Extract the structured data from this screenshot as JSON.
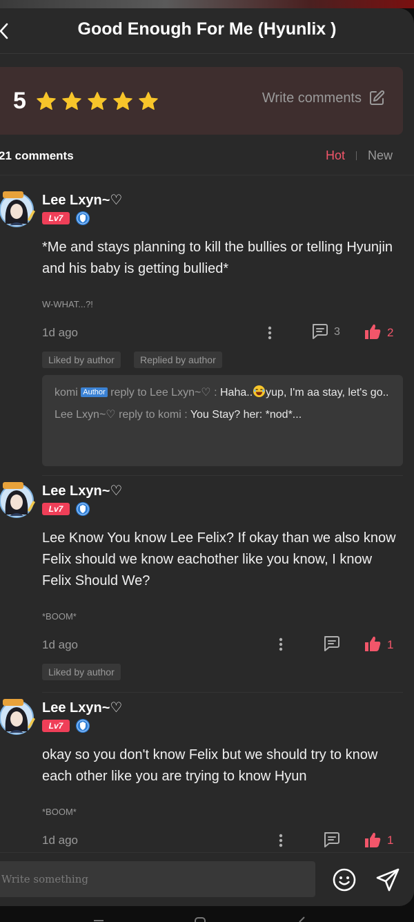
{
  "header": {
    "title": "Good Enough For Me (Hyunlix )"
  },
  "rating": {
    "score": "5",
    "stars": 5,
    "star_color": "#f7c52a",
    "write_comments_label": "Write comments"
  },
  "comments_bar": {
    "count_label": "21 comments",
    "sort_hot": "Hot",
    "sort_new": "New",
    "active_color": "#f2566a"
  },
  "comments": [
    {
      "username": "Lee Lxyn~♡",
      "level": "Lv7",
      "text": "*Me and stays planning to kill the bullies or telling Hyunjin and his baby is getting bullied*",
      "quote": "W-WHAT...?!",
      "time": "1d ago",
      "reply_count": "3",
      "like_count": "2",
      "tags": [
        "Liked by author",
        "Replied by author"
      ],
      "replies": [
        {
          "name": "komi",
          "author_chip": "Author",
          "reply_to": "reply to Lee Lxyn~♡ :",
          "text_before": "Haha..",
          "text_after": "yup, I'm aa stay, let's go.."
        },
        {
          "name": "Lee Lxyn~♡",
          "reply_to": "reply to komi :",
          "text": "You Stay? her: *nod*..."
        }
      ]
    },
    {
      "username": "Lee Lxyn~♡",
      "level": "Lv7",
      "text": "Lee Know You know Lee Felix? If okay than we also know Felix should we know eachother like you know, I know Felix Should We?",
      "quote": "*BOOM*",
      "time": "1d ago",
      "like_count": "1",
      "tags": [
        "Liked by author"
      ]
    },
    {
      "username": "Lee Lxyn~♡",
      "level": "Lv7",
      "text": "okay so you don't know Felix but we should try to know each other like you are trying to know Hyun",
      "quote": "*BOOM*",
      "time": "1d ago",
      "like_count": "1"
    }
  ],
  "composer": {
    "placeholder": "Write something"
  },
  "icons": {
    "back": "chevron-left-icon",
    "edit": "edit-square-icon",
    "more": "more-vertical-icon",
    "reply": "message-square-icon",
    "like": "thumbs-up-icon",
    "smile": "smile-icon",
    "send": "send-icon"
  }
}
